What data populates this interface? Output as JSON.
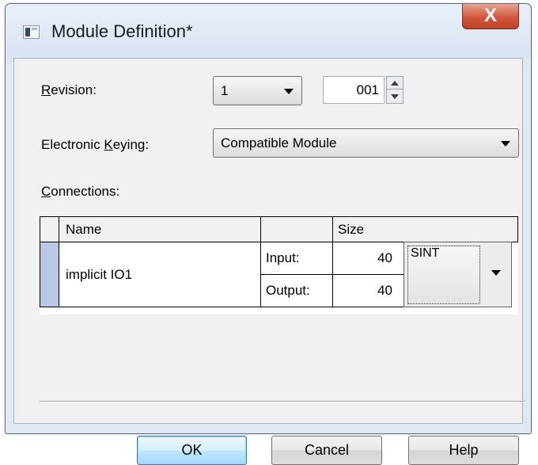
{
  "window": {
    "title": "Module Definition*",
    "close_glyph": "X",
    "icon": "window-app-icon"
  },
  "revision": {
    "label_mnemonic": "R",
    "label_rest": "evision:",
    "major_value": "1",
    "minor_value": "001"
  },
  "keying": {
    "label_prefix": "Electronic ",
    "label_mnemonic": "K",
    "label_rest": "eying:",
    "value": "Compatible Module"
  },
  "connections": {
    "label_mnemonic": "C",
    "label_rest": "onnections:",
    "columns": [
      "Name",
      "",
      "Size"
    ],
    "rows": [
      {
        "name": "implicit IO1",
        "input_label": "Input:",
        "input_size": "40",
        "output_label": "Output:",
        "output_size": "40",
        "data_type": "SINT"
      }
    ]
  },
  "buttons": {
    "ok": "OK",
    "cancel": "Cancel",
    "help": "Help"
  },
  "colors": {
    "close_button": "#c94a2e",
    "row_selector": "#b9c9e3",
    "default_button_border": "#3c7fb1"
  }
}
